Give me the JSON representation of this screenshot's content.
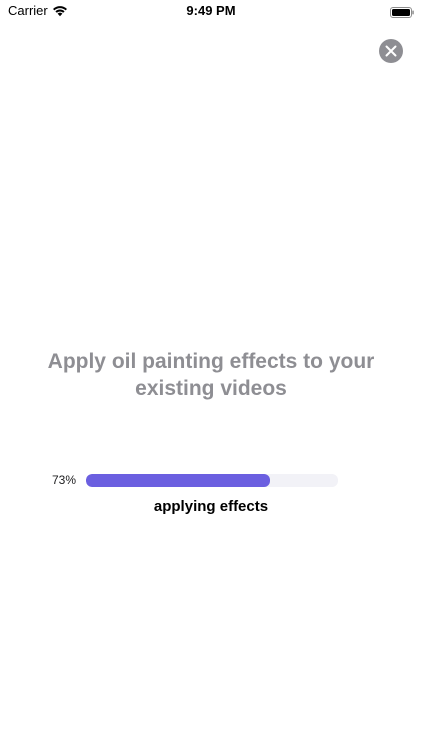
{
  "status_bar": {
    "carrier": "Carrier",
    "time": "9:49 PM",
    "wifi_icon": "wifi-icon",
    "battery_icon": "battery-icon"
  },
  "close_button": {
    "icon": "close-icon"
  },
  "headline": "Apply oil painting effects to your existing videos",
  "progress": {
    "percent_label": "73%",
    "value": 0.73,
    "status": "applying effects"
  },
  "colors": {
    "accent": "#6b5fe0",
    "track": "#f2f2f7",
    "headline_gray": "#8e8e93",
    "close_bg": "#8e8e93"
  }
}
